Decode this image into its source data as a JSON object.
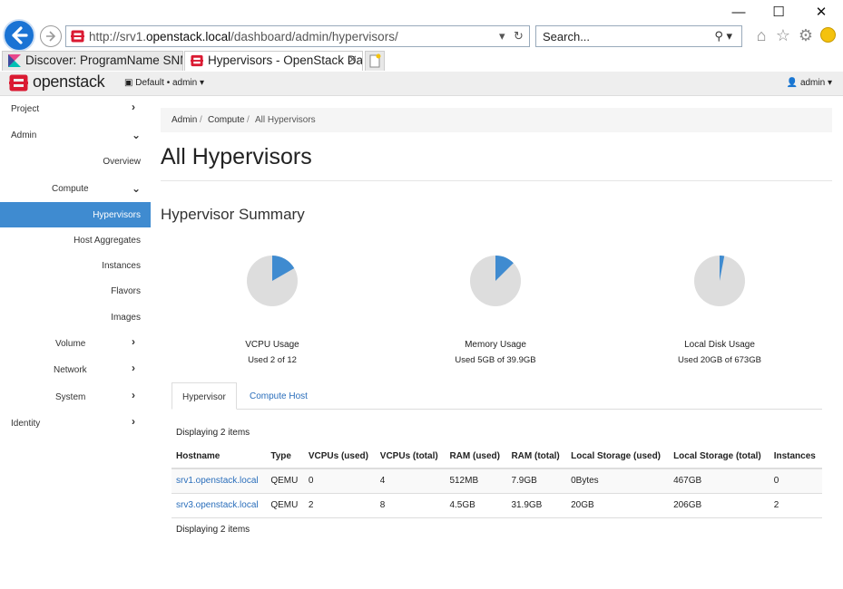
{
  "browser": {
    "url_host": "http://srv1.",
    "url_domain": "openstack.local",
    "url_path": "/dashboard/admin/hypervisors/",
    "search_placeholder": "Search...",
    "tabs": [
      {
        "label": "Discover: ProgramName SNM..."
      },
      {
        "label": "Hypervisors - OpenStack Da..."
      }
    ]
  },
  "header": {
    "brand": "openstack",
    "project_selector": "Default • admin",
    "user_menu": "admin"
  },
  "sidebar": {
    "items": [
      {
        "label": "Project"
      },
      {
        "label": "Admin"
      },
      {
        "label": "Overview"
      },
      {
        "label": "Compute"
      },
      {
        "label": "Hypervisors"
      },
      {
        "label": "Host Aggregates"
      },
      {
        "label": "Instances"
      },
      {
        "label": "Flavors"
      },
      {
        "label": "Images"
      },
      {
        "label": "Volume"
      },
      {
        "label": "Network"
      },
      {
        "label": "System"
      },
      {
        "label": "Identity"
      }
    ]
  },
  "breadcrumb": [
    "Admin",
    "Compute",
    "All Hypervisors"
  ],
  "page_title": "All Hypervisors",
  "summary": {
    "title": "Hypervisor Summary",
    "charts": [
      {
        "title": "VCPU Usage",
        "subtitle": "Used 2 of 12",
        "fraction": 0.1667
      },
      {
        "title": "Memory Usage",
        "subtitle": "Used 5GB of 39.9GB",
        "fraction": 0.1253
      },
      {
        "title": "Local Disk Usage",
        "subtitle": "Used 20GB of 673GB",
        "fraction": 0.0297
      }
    ],
    "colors": {
      "used": "#3f8bd0",
      "free": "#dddddd"
    }
  },
  "tabs": {
    "hypervisor": "Hypervisor",
    "compute_host": "Compute Host"
  },
  "table": {
    "count_top": "Displaying 2 items",
    "count_bottom": "Displaying 2 items",
    "headers": [
      "Hostname",
      "Type",
      "VCPUs (used)",
      "VCPUs (total)",
      "RAM (used)",
      "RAM (total)",
      "Local Storage (used)",
      "Local Storage (total)",
      "Instances"
    ],
    "rows": [
      [
        "srv1.openstack.local",
        "QEMU",
        "0",
        "4",
        "512MB",
        "7.9GB",
        "0Bytes",
        "467GB",
        "0"
      ],
      [
        "srv3.openstack.local",
        "QEMU",
        "2",
        "8",
        "4.5GB",
        "31.9GB",
        "20GB",
        "206GB",
        "2"
      ]
    ]
  }
}
